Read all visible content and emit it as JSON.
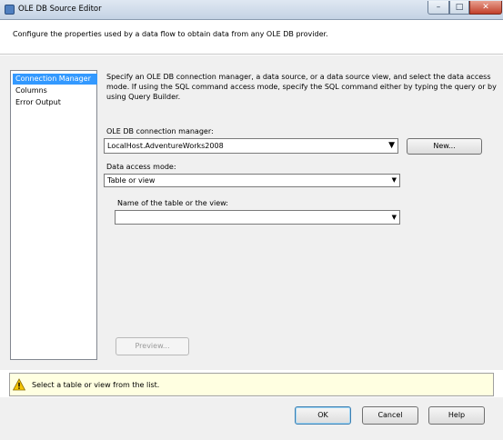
{
  "window": {
    "title": "OLE DB Source Editor",
    "minimize_glyph": "–",
    "maximize_glyph": "□",
    "close_glyph": "✕"
  },
  "header": {
    "description": "Configure the properties used by a data flow to obtain data from any OLE DB provider."
  },
  "nav": {
    "items": [
      {
        "label": "Connection Manager",
        "selected": true
      },
      {
        "label": "Columns",
        "selected": false
      },
      {
        "label": "Error Output",
        "selected": false
      }
    ]
  },
  "main": {
    "description": "Specify an OLE DB connection manager, a data source, or a data source view, and select the data access mode. If using the SQL command access mode, specify the SQL command either by typing the query or by using Query Builder.",
    "connection_label": "OLE DB connection manager:",
    "connection_value": "LocalHost.AdventureWorks2008",
    "new_button": "New...",
    "access_mode_label": "Data access mode:",
    "access_mode_value": "Table or view",
    "table_label": "Name of the table or the view:",
    "table_value": "",
    "preview_button": "Preview..."
  },
  "status": {
    "icon": "warning-icon",
    "message": "Select a table or view from the list."
  },
  "footer": {
    "ok": "OK",
    "cancel": "Cancel",
    "help": "Help"
  },
  "colors": {
    "selection": "#3399ff",
    "status_background": "#ffffe1",
    "warning": "#f5c400"
  }
}
